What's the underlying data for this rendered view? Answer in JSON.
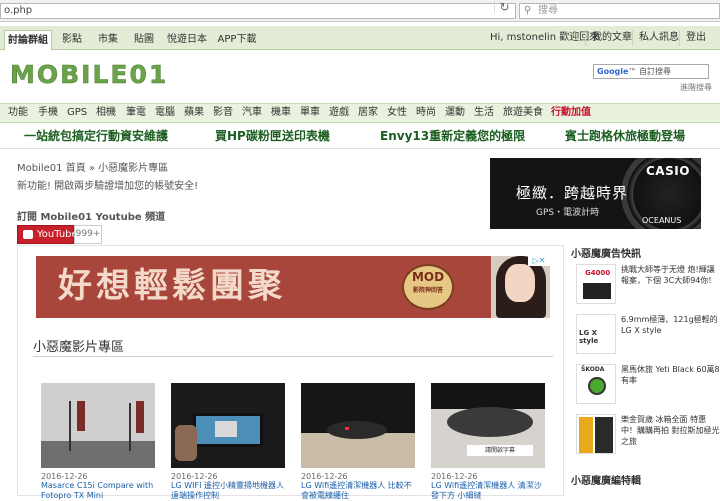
{
  "browser": {
    "url": "o.php",
    "search_placeholder": "搜尋"
  },
  "topnav": {
    "tabs": [
      "討論群組",
      "影點",
      "市集",
      "貼圖",
      "悅遊日本",
      "APP下載"
    ],
    "greeting": "Hi, mstonelin 歡迎回來",
    "user_links": [
      "我的文章",
      "私人訊息",
      "登出"
    ]
  },
  "header": {
    "logo": "MOBILE01",
    "google_search": "自訂搜尋",
    "advanced_search": "進階搜尋"
  },
  "categories": [
    "功能",
    "手機",
    "GPS",
    "相機",
    "筆電",
    "電腦",
    "蘋果",
    "影音",
    "汽車",
    "機車",
    "單車",
    "遊戲",
    "居家",
    "女性",
    "時尚",
    "運動",
    "生活",
    "旅遊美食",
    "行動加值"
  ],
  "promos": [
    "一站統包搞定行動資安維護",
    "買HP碳粉匣送印表機",
    "Envy13重新定義您的極限",
    "賓士跑格休旅極動登場"
  ],
  "breadcrumb": "Mobile01 首頁 » 小惡魔影片專區",
  "notice": "新功能! 開啟兩步驗證增加您的帳號安全!",
  "subscribe": {
    "title": "訂閱 Mobile01 Youtube 頻道",
    "button": "YouTube",
    "count": "999+"
  },
  "ad_casio": {
    "brand": "CASIO",
    "slogan": "極緻．跨越時界",
    "sub": "GPS・電波計時",
    "model": "OCEANUS"
  },
  "banner_ad": {
    "text": "好想輕鬆團聚",
    "badge_main": "MOD",
    "badge_sub": "影院神回答"
  },
  "section_title": "小惡魔影片專區",
  "videos": [
    {
      "date": "2016-12-26",
      "title": "Masarce C15i Compare with Fotopro TX Mini"
    },
    {
      "date": "2016-12-26",
      "title": "LG WIFI 遙控小精靈掃地機器人 遠端操作控制"
    },
    {
      "date": "2016-12-26",
      "title": "LG Wifi遙控清潔機器人 比較不會被電線纏住"
    },
    {
      "date": "2016-12-26",
      "title": "LG Wifi遙控清潔機器人 清潔沙發下方 小細縫"
    }
  ],
  "video3_overlay": "請開啟字幕",
  "sidebar": {
    "title": "小惡魔廣告快訊",
    "items": [
      {
        "brand": "G4000",
        "text": "挑戰大師等于无燈 炮!輝讓報案，下個 3C大師94你!"
      },
      {
        "brand": "LG X style",
        "text": "6.9mm極薄、121g極輕的 LG X style"
      },
      {
        "brand": "ŠKODA",
        "text": "黑馬休旅 Yeti Black 60萬8有率"
      },
      {
        "brand": "",
        "text": "樂金賀歲 冰箱全面 特惠中！購購再拍 對拉斯加極光之旅"
      }
    ],
    "section2": "小惡魔廣編特輯"
  }
}
